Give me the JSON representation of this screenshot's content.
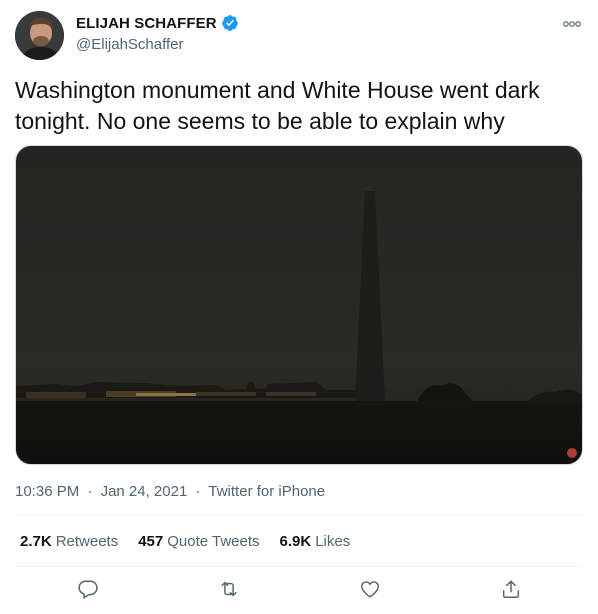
{
  "author": {
    "display_name": "ELIJAH SCHAFFER",
    "handle": "@ElijahSchaffer",
    "verified": true
  },
  "tweet": {
    "text": "Washington monument and White House went dark tonight. No one seems to be able to explain why",
    "time": "10:36 PM",
    "date": "Jan 24, 2021",
    "source": "Twitter for iPhone",
    "separator": "·"
  },
  "stats": {
    "retweets_count": "2.7K",
    "retweets_label": "Retweets",
    "quote_count": "457",
    "quote_label": "Quote Tweets",
    "likes_count": "6.9K",
    "likes_label": "Likes"
  },
  "actions": [
    "reply-icon",
    "retweet-icon",
    "like-icon",
    "share-icon"
  ],
  "colors": {
    "verified_blue": "#1d9bf0",
    "secondary_text": "#536471",
    "primary_text": "#0f1419"
  }
}
